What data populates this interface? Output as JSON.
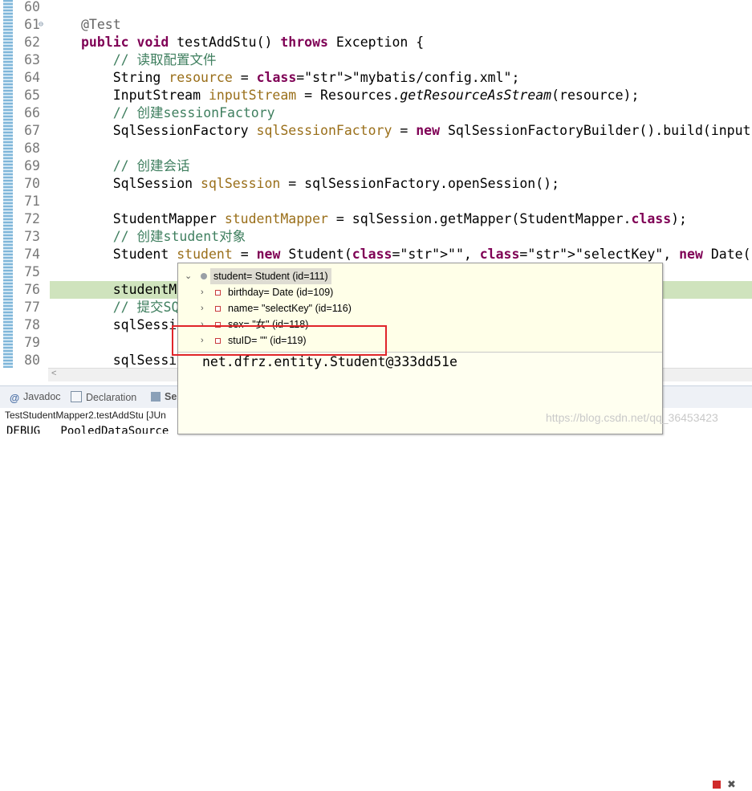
{
  "editor": {
    "lines": [
      {
        "n": "60",
        "text": ""
      },
      {
        "n": "61",
        "text": "@Test",
        "fold": true
      },
      {
        "n": "62",
        "text": "public void testAddStu() throws Exception {"
      },
      {
        "n": "63",
        "text": "    // 读取配置文件"
      },
      {
        "n": "64",
        "text": "    String resource = \"mybatis/config.xml\";"
      },
      {
        "n": "65",
        "text": "    InputStream inputStream = Resources.getResourceAsStream(resource);"
      },
      {
        "n": "66",
        "text": "    // 创建sessionFactory"
      },
      {
        "n": "67",
        "text": "    SqlSessionFactory sqlSessionFactory = new SqlSessionFactoryBuilder().build(input"
      },
      {
        "n": "68",
        "text": ""
      },
      {
        "n": "69",
        "text": "    // 创建会话"
      },
      {
        "n": "70",
        "text": "    SqlSession sqlSession = sqlSessionFactory.openSession();"
      },
      {
        "n": "71",
        "text": ""
      },
      {
        "n": "72",
        "text": "    StudentMapper studentMapper = sqlSession.getMapper(StudentMapper.class);"
      },
      {
        "n": "73",
        "text": "    // 创建student对象"
      },
      {
        "n": "74",
        "text": "    Student student = new Student(\"\", \"selectKey\", new Date(), \"女\");"
      },
      {
        "n": "75",
        "text": ""
      },
      {
        "n": "76",
        "text": "    studentM"
      },
      {
        "n": "77",
        "text": "    // 提交SQ"
      },
      {
        "n": "78",
        "text": "    sqlSessi"
      },
      {
        "n": "79",
        "text": ""
      },
      {
        "n": "80",
        "text": "    sqlSessi"
      }
    ]
  },
  "popup": {
    "root": "student= Student  (id=111)",
    "children": [
      "birthday= Date  (id=109)",
      "name= \"selectKey\" (id=116)",
      "sex= \"女\" (id=118)",
      "stuID= \"\" (id=119)"
    ],
    "detail": "net.dfrz.entity.Student@333dd51e"
  },
  "bottom_tabs": [
    {
      "label": "Javadoc",
      "icon": "at-icon"
    },
    {
      "label": "Declaration",
      "icon": "declaration-icon"
    },
    {
      "label": "Ser",
      "icon": "servers-icon"
    }
  ],
  "console": {
    "title": "TestStudentMapper2.testAddStu [JUn",
    "line": "DEBUG   PooledDataSource ..."
  },
  "watermark": "https://blog.csdn.net/qq_36453423",
  "colors": {
    "keyword": "#7f0055",
    "comment": "#3f7f5f",
    "string": "#2a00ff",
    "highlight": "#cfe3bd",
    "redbox": "#e0252a"
  }
}
